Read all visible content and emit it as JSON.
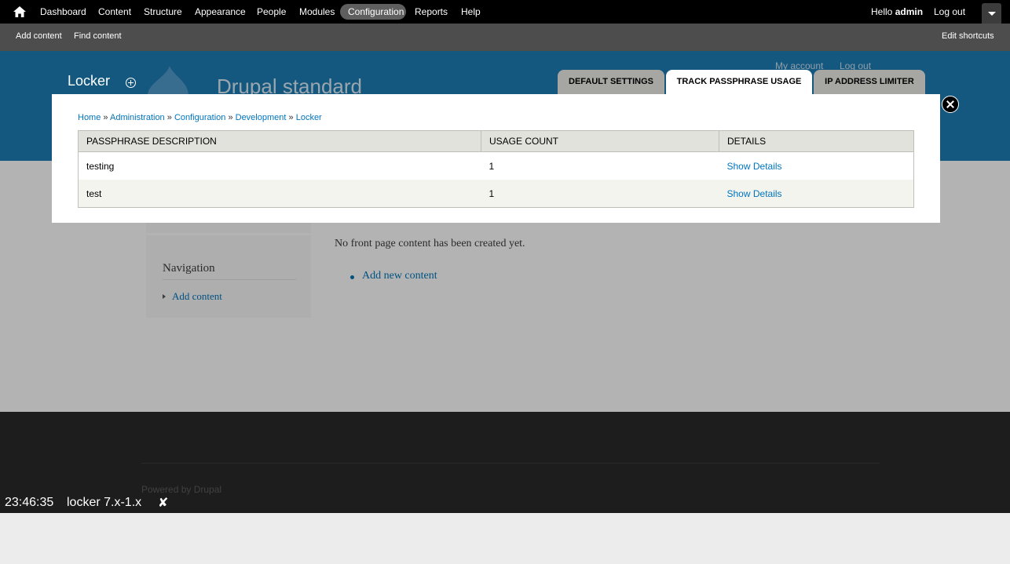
{
  "toolbar": {
    "items": [
      "Dashboard",
      "Content",
      "Structure",
      "Appearance",
      "People",
      "Modules",
      "Configuration",
      "Reports",
      "Help"
    ],
    "hello_prefix": "Hello ",
    "user": "admin",
    "logout": "Log out"
  },
  "shortcuts": {
    "add_content": "Add content",
    "find_content": "Find content",
    "edit_shortcuts": "Edit shortcuts"
  },
  "page": {
    "site_name": "Drupal standard",
    "secondary": [
      "My account",
      "Log out"
    ],
    "navigation_title": "Navigation",
    "navigation_item": "Add content",
    "front_message": "No front page content has been created yet.",
    "front_link": "Add new content",
    "powered_by": "Powered by ",
    "powered_link": "Drupal"
  },
  "overlay": {
    "title": "Locker",
    "tabs": [
      "DEFAULT SETTINGS",
      "TRACK PASSPHRASE USAGE",
      "IP ADDRESS LIMITER"
    ],
    "breadcrumb": [
      "Home",
      "Administration",
      "Configuration",
      "Development",
      "Locker"
    ],
    "breadcrumb_sep": "»",
    "table": {
      "headers": [
        "PASSPHRASE DESCRIPTION",
        "USAGE COUNT",
        "DETAILS"
      ],
      "rows": [
        {
          "description": "testing",
          "count": "1",
          "details": "Show Details"
        },
        {
          "description": "test",
          "count": "1",
          "details": "Show Details"
        }
      ]
    }
  },
  "timer": {
    "time": "23:46:35",
    "version": "locker 7.x-1.x",
    "close": "✘"
  },
  "colors": {
    "toolbar": "#000000",
    "shortcuts": "#4d4d4d",
    "header": "#1c7bb2",
    "link": "#0074bd",
    "footer": "#292929"
  }
}
